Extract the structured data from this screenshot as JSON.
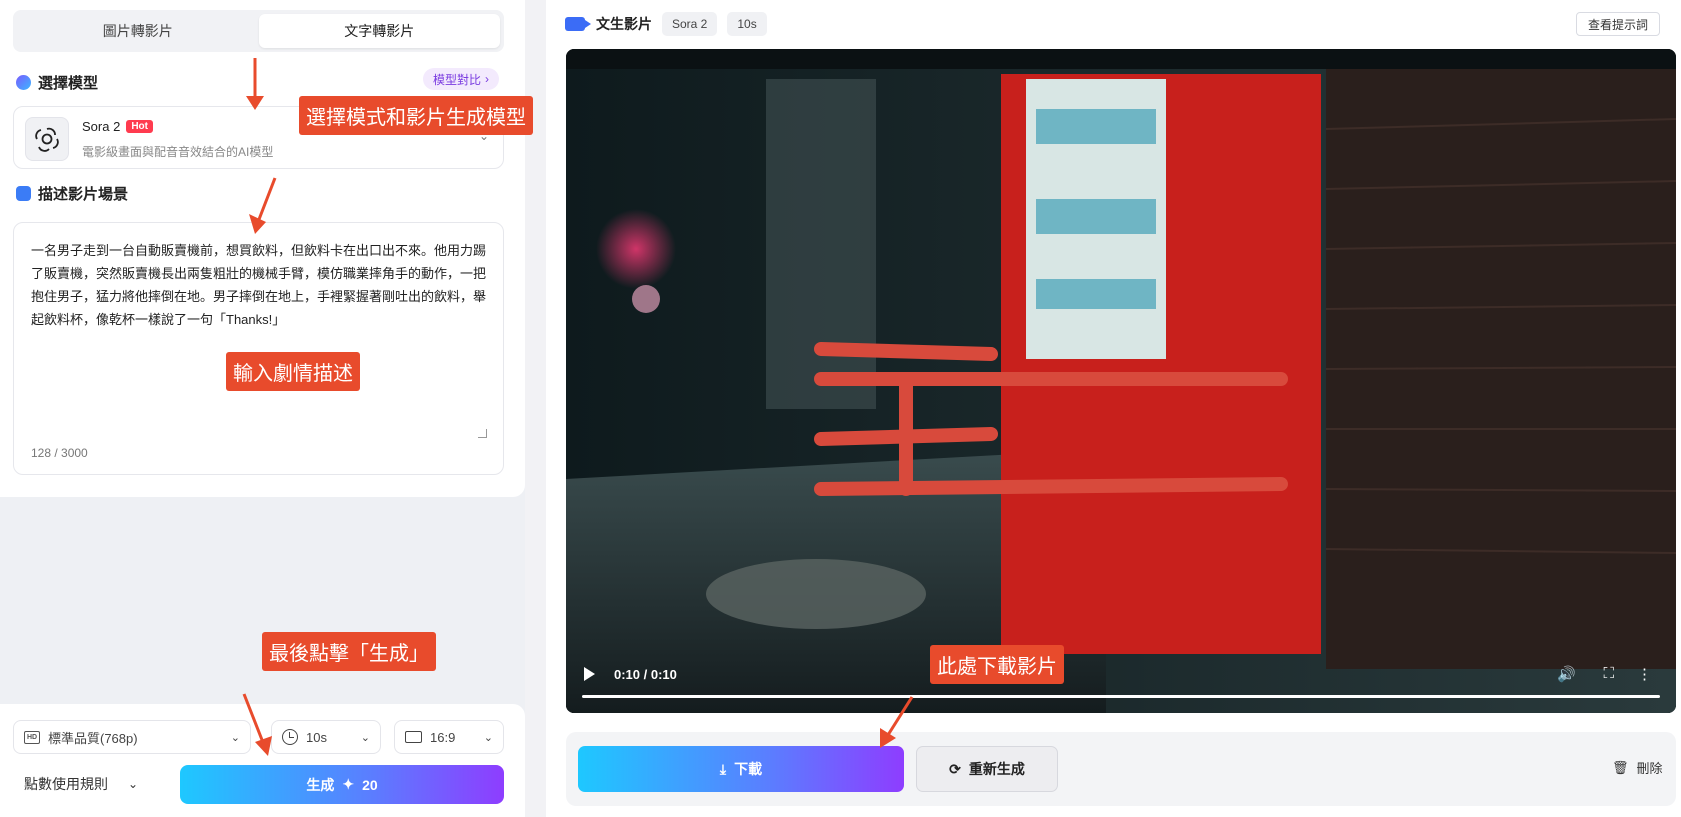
{
  "left": {
    "tabs": [
      "圖片轉影片",
      "文字轉影片"
    ],
    "active_tab": 1,
    "model_section": {
      "title": "選擇模型",
      "compare_label": "模型對比",
      "model_name": "Sora 2",
      "model_badge": "Hot",
      "model_desc": "電影級畫面與配音音效結合的AI模型"
    },
    "prompt_section": {
      "title": "描述影片場景",
      "text": "一名男子走到一台自動販賣機前，想買飲料，但飲料卡在出口出不來。他用力踢了販賣機，突然販賣機長出兩隻粗壯的機械手臂，模仿職業摔角手的動作，一把抱住男子，猛力將他摔倒在地。男子摔倒在地上，手裡緊握著剛吐出的飲料，舉起飲料杯，像乾杯一樣說了一句「Thanks!」",
      "count": "128 / 3000"
    },
    "bottom": {
      "quality": "標準品質(768p)",
      "duration": "10s",
      "ratio": "16:9",
      "rules_label": "點數使用規則",
      "generate_label": "生成",
      "generate_cost": "20"
    }
  },
  "right": {
    "header": {
      "title": "文生影片",
      "model_chip": "Sora 2",
      "duration_chip": "10s",
      "view_prompt": "查看提示詞"
    },
    "video": {
      "time": "0:10 / 0:10",
      "progress": 1.0
    },
    "actions": {
      "download": "下載",
      "regenerate": "重新生成",
      "delete": "刪除"
    }
  },
  "annotations": {
    "select_model": "選擇模式和影片生成模型",
    "input_story": "輸入劇情描述",
    "click_generate": "最後點擊「生成」",
    "download_here": "此處下載影片",
    "color": "#e84b2c"
  }
}
